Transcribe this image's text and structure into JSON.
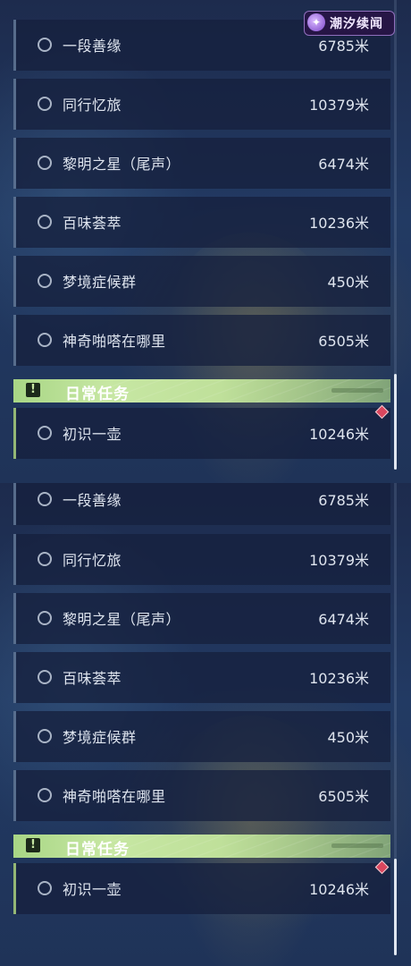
{
  "logo": {
    "text": "潮汐续闻"
  },
  "quests": [
    {
      "name": "一段善缘",
      "distance": "6785米"
    },
    {
      "name": "同行忆旅",
      "distance": "10379米"
    },
    {
      "name": "黎明之星（尾声）",
      "distance": "6474米"
    },
    {
      "name": "百味荟萃",
      "distance": "10236米"
    },
    {
      "name": "梦境症候群",
      "distance": "450米"
    },
    {
      "name": "神奇啪嗒在哪里",
      "distance": "6505米"
    }
  ],
  "daily_section": {
    "title": "日常任务",
    "icon": "exclamation-icon",
    "quests": [
      {
        "name": "初识一壶",
        "distance": "10246米",
        "badge": "red-diamond"
      }
    ]
  },
  "colors": {
    "section_header": "#c7e7a3",
    "row_background": "#16203e",
    "text": "#dfe5ef",
    "badge": "#d9465e"
  }
}
